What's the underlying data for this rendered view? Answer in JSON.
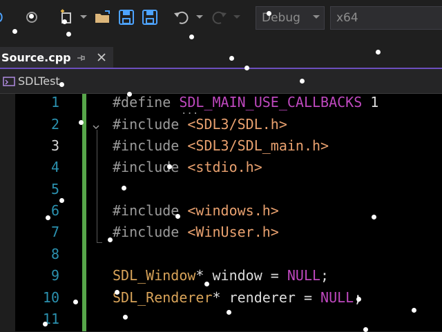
{
  "toolbar": {
    "configuration": "Debug",
    "platform": "x64",
    "icons": [
      "circle-arrow-icon",
      "new-project-icon",
      "open-folder-icon",
      "save-icon",
      "save-all-icon",
      "undo-icon",
      "redo-icon"
    ]
  },
  "tabs": [
    {
      "label": "Source.cpp",
      "pinned": true,
      "active": true
    }
  ],
  "navigation": {
    "project": "SDLTest"
  },
  "editor": {
    "current_line": 3,
    "lines": [
      {
        "number": "1",
        "text": "#define SDL_MAIN_USE_CALLBACKS 1"
      },
      {
        "number": "2",
        "text": "#include <SDL3/SDL.h>"
      },
      {
        "number": "3",
        "text": "#include <SDL3/SDL_main.h>"
      },
      {
        "number": "4",
        "text": "#include <stdio.h>"
      },
      {
        "number": "5",
        "text": ""
      },
      {
        "number": "6",
        "text": "#include <windows.h>"
      },
      {
        "number": "7",
        "text": "#include <WinUser.h>"
      },
      {
        "number": "8",
        "text": ""
      },
      {
        "number": "9",
        "text": "SDL_Window* window = NULL;"
      },
      {
        "number": "10",
        "text": "SDL_Renderer* renderer = NULL;"
      },
      {
        "number": "11",
        "text": ""
      }
    ],
    "tokens": {
      "l1": {
        "kw": "#define",
        "macro": "SDL_MAIN_USE_CALLBACKS",
        "value": "1"
      },
      "l2": {
        "kw": "#include",
        "path": "<SDL3/SDL.h>"
      },
      "l3": {
        "kw": "#include",
        "path": "<SDL3/SDL_main.h>"
      },
      "l4": {
        "kw": "#include",
        "path": "<stdio.h>"
      },
      "l6": {
        "kw": "#include",
        "path": "<windows.h>"
      },
      "l7": {
        "kw": "#include",
        "path": "<WinUser.h>"
      },
      "l9": {
        "type": "SDL_Window",
        "rest": "* window = ",
        "null": "NULL",
        "end": ";"
      },
      "l10": {
        "type": "SDL_Renderer",
        "rest": "* renderer = ",
        "null": "NULL",
        "end": ";"
      }
    }
  },
  "colors": {
    "background": "#000000",
    "line_number": "#2b91af",
    "preprocessor": "#9b9b9b",
    "include_path": "#e9a16f",
    "macro": "#be48be",
    "type": "#d8a359",
    "change_bar": "#57a64a",
    "accent": "#6c4fbf"
  }
}
